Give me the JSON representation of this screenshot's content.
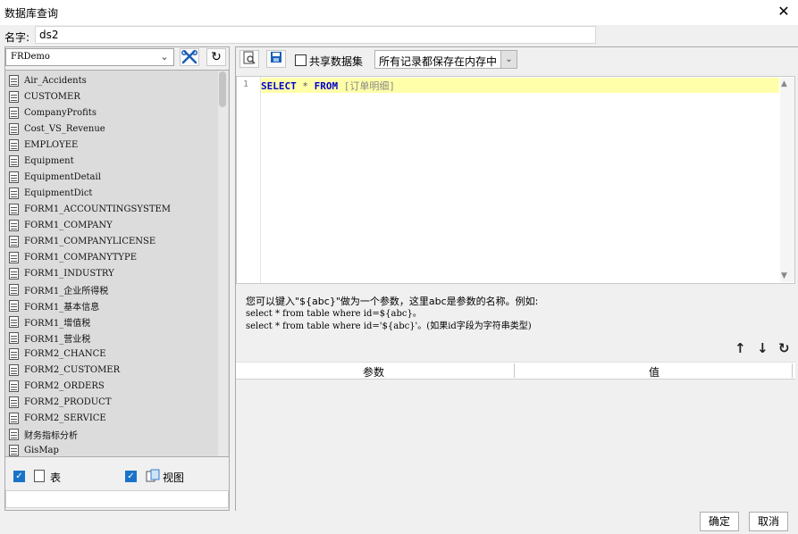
{
  "window": {
    "title": "数据库查询",
    "close": "✕"
  },
  "name": {
    "label": "名字:",
    "value": "ds2"
  },
  "datasource": {
    "selected": "FRDemo",
    "arrow": "⌄"
  },
  "toolbar": {
    "connect_icon": "wrench-icon",
    "refresh": "↻"
  },
  "tables": [
    "Air_Accidents",
    "CUSTOMER",
    "CompanyProfits",
    "Cost_VS_Revenue",
    "EMPLOYEE",
    "Equipment",
    "EquipmentDetail",
    "EquipmentDict",
    "FORM1_ACCOUNTINGSYSTEM",
    "FORM1_COMPANY",
    "FORM1_COMPANYLICENSE",
    "FORM1_COMPANYTYPE",
    "FORM1_INDUSTRY",
    "FORM1_企业所得税",
    "FORM1_基本信息",
    "FORM1_增值税",
    "FORM1_营业税",
    "FORM2_CHANCE",
    "FORM2_CUSTOMER",
    "FORM2_ORDERS",
    "FORM2_PRODUCT",
    "FORM2_SERVICE",
    "财务指标分析",
    "GisMap"
  ],
  "filters": {
    "table_label": "表",
    "view_label": "视图",
    "check": "✓"
  },
  "right_toolbar": {
    "share_label": "共享数据集",
    "memory_option": "所有记录都保存在内存中",
    "arrow": "⌄"
  },
  "editor": {
    "line_number": "1",
    "kw1": "SELECT",
    "op": "*",
    "kw2": "FROM",
    "table": "[订单明细]",
    "up": "▲",
    "down": "▼"
  },
  "hint": {
    "line1": "您可以键入\"${abc}\"做为一个参数，这里abc是参数的名称。例如:",
    "line2": "select * from table where id=${abc}。",
    "line3": "select * from table where id='${abc}'。(如果id字段为字符串类型)"
  },
  "param_table": {
    "col1": "参数",
    "col2": "值"
  },
  "param_actions": {
    "up": "↑",
    "down": "↓",
    "refresh": "↻"
  },
  "footer": {
    "ok": "确定",
    "cancel": "取消"
  }
}
